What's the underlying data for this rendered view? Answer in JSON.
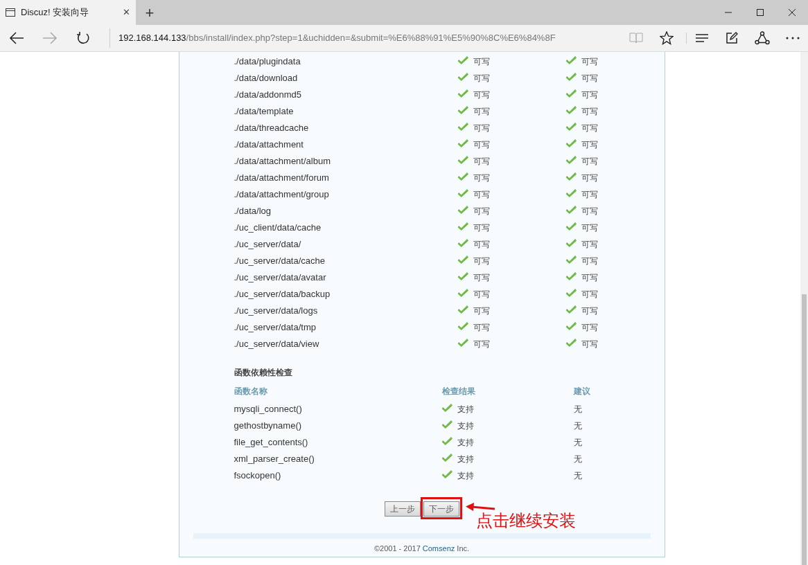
{
  "browser": {
    "tab_title": "Discuz! 安装向导",
    "tab_close": "✕",
    "new_tab": "+",
    "url_host": "192.168.144.133",
    "url_path": "/bbs/install/index.php?step=1&uchidden=&submit=%E6%88%91%E5%90%8C%E6%84%8F"
  },
  "directories": [
    {
      "path": "./data/plugindata",
      "current": {
        "ok": true,
        "text": "可写"
      },
      "required": {
        "ok": true,
        "text": "可写"
      }
    },
    {
      "path": "./data/download",
      "current": {
        "ok": true,
        "text": "可写"
      },
      "required": {
        "ok": true,
        "text": "可写"
      }
    },
    {
      "path": "./data/addonmd5",
      "current": {
        "ok": true,
        "text": "可写"
      },
      "required": {
        "ok": true,
        "text": "可写"
      }
    },
    {
      "path": "./data/template",
      "current": {
        "ok": true,
        "text": "可写"
      },
      "required": {
        "ok": true,
        "text": "可写"
      }
    },
    {
      "path": "./data/threadcache",
      "current": {
        "ok": true,
        "text": "可写"
      },
      "required": {
        "ok": true,
        "text": "可写"
      }
    },
    {
      "path": "./data/attachment",
      "current": {
        "ok": true,
        "text": "可写"
      },
      "required": {
        "ok": true,
        "text": "可写"
      }
    },
    {
      "path": "./data/attachment/album",
      "current": {
        "ok": true,
        "text": "可写"
      },
      "required": {
        "ok": true,
        "text": "可写"
      }
    },
    {
      "path": "./data/attachment/forum",
      "current": {
        "ok": true,
        "text": "可写"
      },
      "required": {
        "ok": true,
        "text": "可写"
      }
    },
    {
      "path": "./data/attachment/group",
      "current": {
        "ok": true,
        "text": "可写"
      },
      "required": {
        "ok": true,
        "text": "可写"
      }
    },
    {
      "path": "./data/log",
      "current": {
        "ok": true,
        "text": "可写"
      },
      "required": {
        "ok": true,
        "text": "可写"
      }
    },
    {
      "path": "./uc_client/data/cache",
      "current": {
        "ok": true,
        "text": "可写"
      },
      "required": {
        "ok": true,
        "text": "可写"
      }
    },
    {
      "path": "./uc_server/data/",
      "current": {
        "ok": true,
        "text": "可写"
      },
      "required": {
        "ok": true,
        "text": "可写"
      }
    },
    {
      "path": "./uc_server/data/cache",
      "current": {
        "ok": true,
        "text": "可写"
      },
      "required": {
        "ok": true,
        "text": "可写"
      }
    },
    {
      "path": "./uc_server/data/avatar",
      "current": {
        "ok": true,
        "text": "可写"
      },
      "required": {
        "ok": true,
        "text": "可写"
      }
    },
    {
      "path": "./uc_server/data/backup",
      "current": {
        "ok": true,
        "text": "可写"
      },
      "required": {
        "ok": true,
        "text": "可写"
      }
    },
    {
      "path": "./uc_server/data/logs",
      "current": {
        "ok": true,
        "text": "可写"
      },
      "required": {
        "ok": true,
        "text": "可写"
      }
    },
    {
      "path": "./uc_server/data/tmp",
      "current": {
        "ok": true,
        "text": "可写"
      },
      "required": {
        "ok": true,
        "text": "可写"
      }
    },
    {
      "path": "./uc_server/data/view",
      "current": {
        "ok": true,
        "text": "可写"
      },
      "required": {
        "ok": true,
        "text": "可写"
      }
    }
  ],
  "functions": {
    "title": "函数依赖性检查",
    "columns": [
      "函数名称",
      "检查结果",
      "建议"
    ],
    "rows": [
      {
        "name": "mysqli_connect()",
        "ok": true,
        "result": "支持",
        "advice": "无"
      },
      {
        "name": "gethostbyname()",
        "ok": true,
        "result": "支持",
        "advice": "无"
      },
      {
        "name": "file_get_contents()",
        "ok": true,
        "result": "支持",
        "advice": "无"
      },
      {
        "name": "xml_parser_create()",
        "ok": true,
        "result": "支持",
        "advice": "无"
      },
      {
        "name": "fsockopen()",
        "ok": true,
        "result": "支持",
        "advice": "无"
      }
    ]
  },
  "buttons": [
    {
      "label": "上一步",
      "highlighted": false
    },
    {
      "label": "下一步",
      "highlighted": true
    }
  ],
  "annotation": "点击继续安装",
  "footer": {
    "prefix": "©2001 - 2017 ",
    "link": "Comsenz",
    "suffix": " Inc."
  }
}
